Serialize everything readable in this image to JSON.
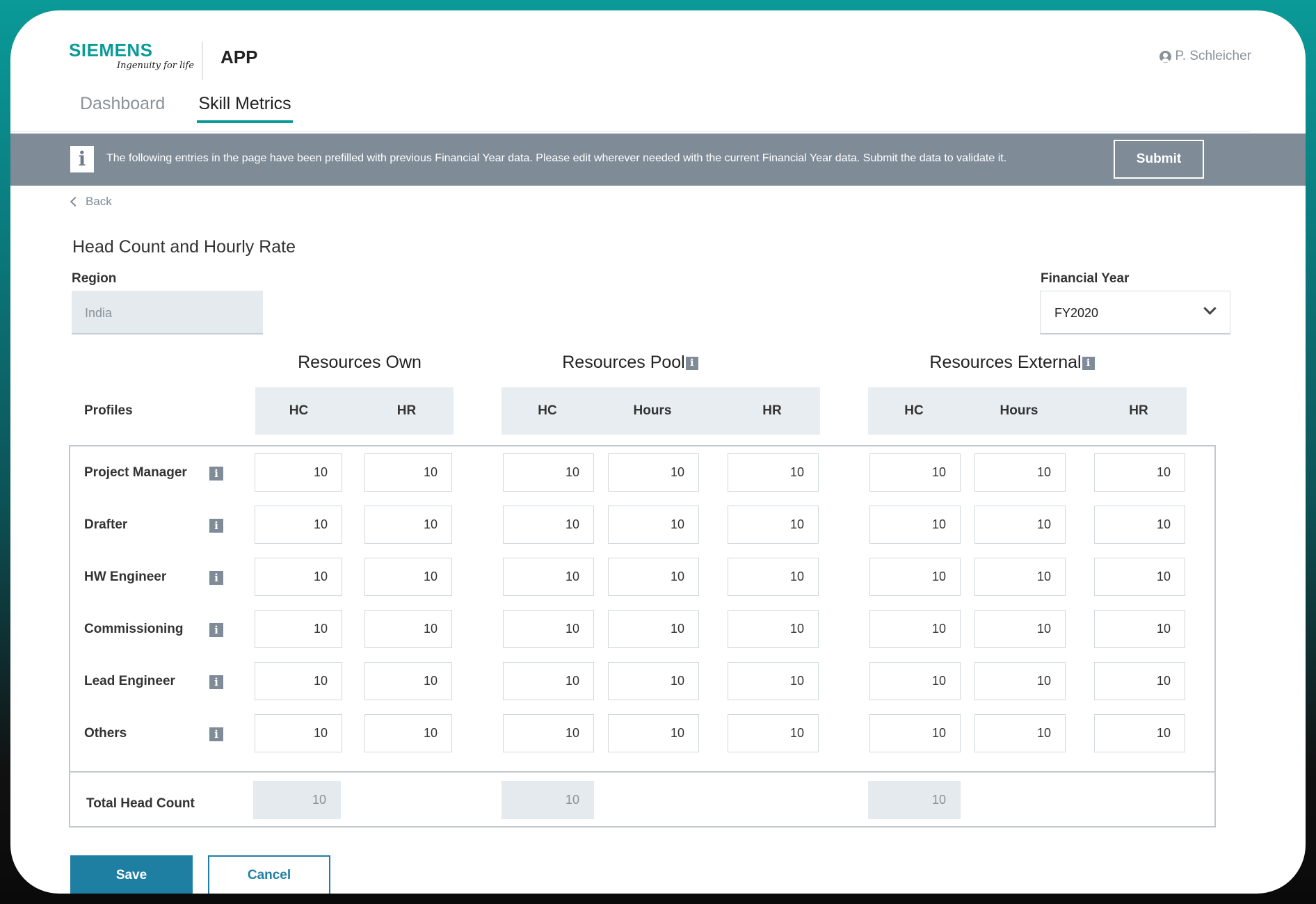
{
  "header": {
    "logo_text": "SIEMENS",
    "logo_tagline": "Ingenuity for life",
    "app_title": "APP",
    "user_name": "P. Schleicher"
  },
  "tabs": [
    {
      "label": "Dashboard",
      "active": false
    },
    {
      "label": "Skill Metrics",
      "active": true
    }
  ],
  "banner": {
    "text": "The following entries in the page have been prefilled with previous Financial Year data. Please edit wherever needed with the current Financial Year data. Submit the data to validate it.",
    "submit_label": "Submit"
  },
  "back_label": "Back",
  "page_title": "Head Count and Hourly Rate",
  "region": {
    "label": "Region",
    "value": "India"
  },
  "financial_year": {
    "label": "Financial Year",
    "value": "FY2020"
  },
  "groups": [
    {
      "title": "Resources Own",
      "columns": [
        "HC",
        "HR"
      ]
    },
    {
      "title": "Resources Pool",
      "columns": [
        "HC",
        "Hours",
        "HR"
      ]
    },
    {
      "title": "Resources External",
      "columns": [
        "HC",
        "Hours",
        "HR"
      ]
    }
  ],
  "profiles_header": "Profiles",
  "rows": [
    {
      "profile": "Project Manager",
      "values": [
        "10",
        "10",
        "10",
        "10",
        "10",
        "10",
        "10",
        "10"
      ]
    },
    {
      "profile": "Drafter",
      "values": [
        "10",
        "10",
        "10",
        "10",
        "10",
        "10",
        "10",
        "10"
      ]
    },
    {
      "profile": "HW Engineer",
      "values": [
        "10",
        "10",
        "10",
        "10",
        "10",
        "10",
        "10",
        "10"
      ]
    },
    {
      "profile": "Commissioning",
      "values": [
        "10",
        "10",
        "10",
        "10",
        "10",
        "10",
        "10",
        "10"
      ]
    },
    {
      "profile": "Lead Engineer",
      "values": [
        "10",
        "10",
        "10",
        "10",
        "10",
        "10",
        "10",
        "10"
      ]
    },
    {
      "profile": "Others",
      "values": [
        "10",
        "10",
        "10",
        "10",
        "10",
        "10",
        "10",
        "10"
      ]
    }
  ],
  "totals": {
    "label": "Total Head Count",
    "values": [
      "10",
      "10",
      "10"
    ]
  },
  "actions": {
    "save_label": "Save",
    "cancel_label": "Cancel"
  },
  "colors": {
    "brand_teal": "#0a9a98",
    "banner_gray": "#7f8c98",
    "primary_blue": "#1f7fa3"
  },
  "icons": {
    "info": "info-icon",
    "user": "user-circle-icon",
    "back": "chevron-left-icon",
    "dropdown": "chevron-down-icon"
  }
}
